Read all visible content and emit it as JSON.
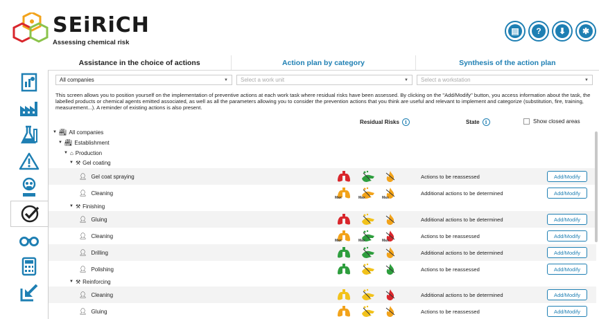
{
  "app": {
    "brand": "SEiRiCH",
    "tagline": "Assessing chemical risk",
    "top_buttons": [
      {
        "name": "folder-icon",
        "glyph": "▰"
      },
      {
        "name": "help-icon",
        "glyph": "?"
      },
      {
        "name": "download-icon",
        "glyph": "⬇"
      },
      {
        "name": "settings-icon",
        "glyph": "✱"
      }
    ]
  },
  "sidebar": {
    "items": [
      {
        "name": "report-icon",
        "active": false
      },
      {
        "name": "factory-icon",
        "active": false
      },
      {
        "name": "flask-icon",
        "active": false
      },
      {
        "name": "warning-icon",
        "active": false
      },
      {
        "name": "ppe-icon",
        "active": false
      },
      {
        "name": "checkmark-icon",
        "active": true
      },
      {
        "name": "binoculars-icon",
        "active": false
      },
      {
        "name": "calculator-icon",
        "active": false
      },
      {
        "name": "export-arrow-icon",
        "active": false
      }
    ]
  },
  "tabs": [
    {
      "label": "Assistance in the choice of actions",
      "active": true
    },
    {
      "label": "Action plan by category",
      "active": false
    },
    {
      "label": "Synthesis of the action plan",
      "active": false
    }
  ],
  "filters": {
    "company": "All companies",
    "work_unit_placeholder": "Select a work unit",
    "workstation_placeholder": "Select a workstation"
  },
  "intro": "This screen allows you to position yourself on the implementation of preventive actions at each work task where residual risks have been assessed. By clicking on the \"Add/Modify\" button, you access information about the task, the labelled products or chemical agents emitted associated, as well as all the parameters allowing you to consider the prevention actions that you think are useful and relevant to implement and categorize (substitution, fire, training, measurement...). A reminder of existing actions is also present.",
  "columns": {
    "residual_risks": "Residual Risks",
    "state": "State",
    "show_closed": "Show closed areas"
  },
  "tree": {
    "root": "All companies",
    "establishment": "Establishment",
    "production": "Production",
    "groups": [
      {
        "label": "Gel coating"
      },
      {
        "label": "Finishing"
      },
      {
        "label": "Reinforcing"
      }
    ]
  },
  "button_label": "Add/Modify",
  "max_label": "Max",
  "colors": {
    "accent": "#1e7fb3",
    "red": "#d9262c",
    "orange": "#f2a31b",
    "green": "#2e9e3e",
    "yellow": "#f2c21b"
  },
  "tasks": [
    {
      "label": "Gel coat spraying",
      "state": "Actions to be reassessed",
      "risks": [
        {
          "k": "lungs",
          "c": "red"
        },
        {
          "k": "hand",
          "c": "green"
        },
        {
          "k": "fire",
          "c": "orange"
        }
      ]
    },
    {
      "label": "Cleaning",
      "state": "Additional actions to be determined",
      "risks": [
        {
          "k": "lungs",
          "c": "orange",
          "max": true
        },
        {
          "k": "hand",
          "c": "orange",
          "max": true
        },
        {
          "k": "fire",
          "c": "orange",
          "max": true
        }
      ]
    },
    {
      "label": "Gluing",
      "state": "Additional actions to be determined",
      "risks": [
        {
          "k": "lungs",
          "c": "red"
        },
        {
          "k": "hand",
          "c": "yellow"
        },
        {
          "k": "fire",
          "c": "orange"
        }
      ]
    },
    {
      "label": "Cleaning",
      "state": "Actions to be reassessed",
      "risks": [
        {
          "k": "lungs",
          "c": "orange",
          "max": true
        },
        {
          "k": "hand",
          "c": "green",
          "max": true
        },
        {
          "k": "fire",
          "c": "red",
          "max": true
        }
      ]
    },
    {
      "label": "Drilling",
      "state": "Additional actions to be determined",
      "risks": [
        {
          "k": "lungs",
          "c": "green"
        },
        {
          "k": "hand",
          "c": "green"
        },
        {
          "k": "fire",
          "c": "orange"
        }
      ]
    },
    {
      "label": "Polishing",
      "state": "Actions to be reassessed",
      "risks": [
        {
          "k": "lungs",
          "c": "green"
        },
        {
          "k": "hand",
          "c": "yellow"
        },
        {
          "k": "fire",
          "c": "green"
        }
      ]
    },
    {
      "label": "Cleaning",
      "state": "Additional actions to be determined",
      "risks": [
        {
          "k": "lungs",
          "c": "yellow"
        },
        {
          "k": "hand",
          "c": "yellow"
        },
        {
          "k": "fire",
          "c": "red"
        }
      ]
    },
    {
      "label": "Gluing",
      "state": "Actions to be reassessed",
      "risks": [
        {
          "k": "lungs",
          "c": "orange"
        },
        {
          "k": "hand",
          "c": "yellow"
        },
        {
          "k": "fire",
          "c": "orange"
        }
      ]
    }
  ]
}
